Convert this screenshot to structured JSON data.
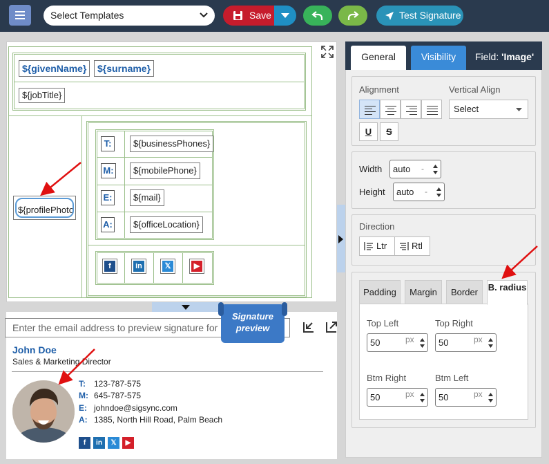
{
  "toolbar": {
    "template_select": "Select Templates",
    "save_label": "Save",
    "test_label": "Test Signature"
  },
  "editor": {
    "given_name": "${givenName}",
    "surname": "${surname}",
    "job_title": "${jobTitle}",
    "profile_photo": "${profilePhoto}",
    "contacts": [
      {
        "label": "T:",
        "value": "${businessPhones}"
      },
      {
        "label": "M:",
        "value": "${mobilePhone}"
      },
      {
        "label": "E:",
        "value": "${mail}"
      },
      {
        "label": "A:",
        "value": "${officeLocation}"
      }
    ]
  },
  "preview": {
    "email_placeholder": "Enter the email address to preview signature for",
    "ribbon_label": "Signature preview",
    "name": "John Doe",
    "title": "Sales & Marketing Director",
    "contacts": [
      {
        "label": "T:",
        "value": "123-787-575"
      },
      {
        "label": "M:",
        "value": "645-787-575"
      },
      {
        "label": "E:",
        "value": "johndoe@sigsync.com"
      },
      {
        "label": "A:",
        "value": "1385, North Hill Road, Palm Beach"
      }
    ]
  },
  "panel": {
    "tabs": {
      "general": "General",
      "visibility": "Visibility"
    },
    "field_prefix": "Field:",
    "field_name": "'Image'",
    "alignment_label": "Alignment",
    "valign_label": "Vertical Align",
    "valign_value": "Select",
    "underline": "U",
    "strike": "S",
    "width_label": "Width",
    "width_value": "auto",
    "height_label": "Height",
    "height_value": "auto",
    "dash": "-",
    "direction_label": "Direction",
    "ltr": "Ltr",
    "rtl": "Rtl",
    "subtabs": {
      "padding": "Padding",
      "margin": "Margin",
      "border": "Border",
      "b_radius": "B. radius"
    },
    "radius": {
      "top_left_label": "Top Left",
      "top_left": "50",
      "top_right_label": "Top Right",
      "top_right": "50",
      "btm_right_label": "Btm Right",
      "btm_right": "50",
      "btm_left_label": "Btm Left",
      "btm_left": "50",
      "unit": "px"
    }
  },
  "colors": {
    "accent": "#1e5ea8",
    "save": "#c61c2c",
    "topbar": "#2a3a4e"
  },
  "icons": {
    "social": [
      "facebook-icon",
      "linkedin-icon",
      "x-icon",
      "youtube-icon"
    ]
  }
}
